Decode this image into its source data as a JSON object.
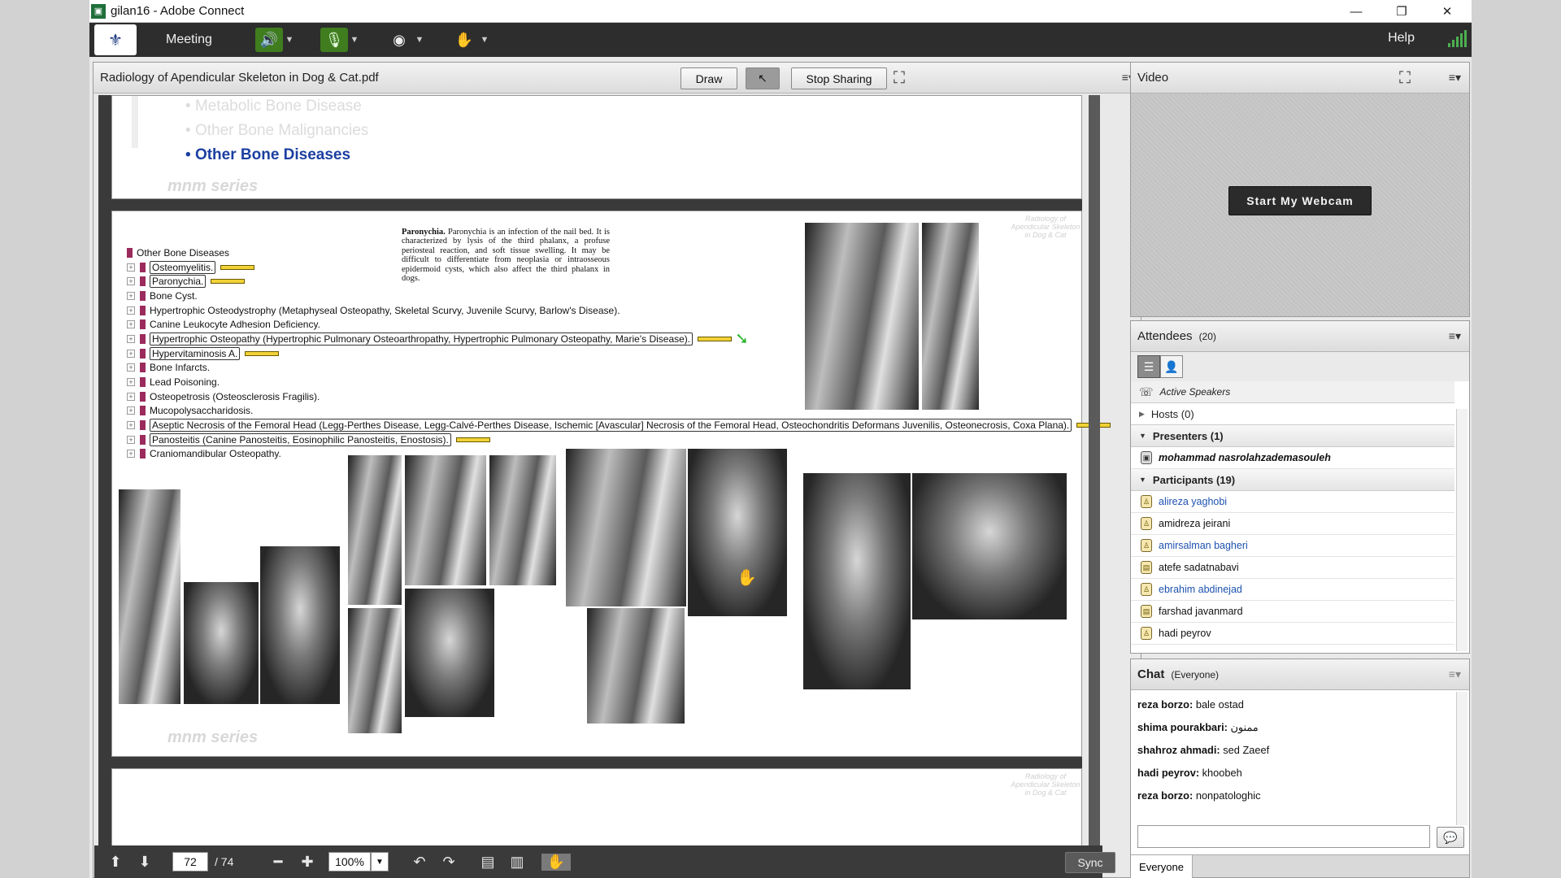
{
  "window": {
    "title": "gilan16 - Adobe Connect"
  },
  "menubar": {
    "meeting": "Meeting",
    "help": "Help"
  },
  "share_pod": {
    "title": "Radiology of Apendicular Skeleton in Dog & Cat.pdf",
    "draw": "Draw",
    "stop_sharing": "Stop Sharing"
  },
  "page_top": {
    "bullets": [
      "Metabolic Bone Disease",
      "Other Bone Malignancies",
      "Other Bone Diseases"
    ],
    "series": "mnm series"
  },
  "page_main": {
    "tree_title": "Other Bone Diseases",
    "items": [
      "Osteomyelitis.",
      "Paronychia.",
      "Bone Cyst.",
      "Hypertrophic Osteodystrophy (Metaphyseal Osteopathy, Skeletal Scurvy, Juvenile Scurvy, Barlow's Disease).",
      "Canine Leukocyte Adhesion Deficiency.",
      "Hypertrophic Osteopathy (Hypertrophic Pulmonary Osteoarthropathy, Hypertrophic Pulmonary Osteopathy, Marie's Disease).",
      "Hypervitaminosis A.",
      "Bone Infarcts.",
      "Lead Poisoning.",
      "Osteopetrosis (Osteosclerosis Fragilis).",
      "Mucopolysaccharidosis.",
      "Aseptic Necrosis of the Femoral Head (Legg-Perthes Disease, Legg-Calvé-Perthes Disease, Ischemic [Avascular] Necrosis of the Femoral Head, Osteochondritis Deformans Juvenilis, Osteonecrosis, Coxa Plana).",
      "Panosteitis (Canine Panosteitis, Eosinophilic Panosteitis, Enostosis).",
      "Craniomandibular Osteopathy."
    ],
    "paragraph_head": "Paronychia.",
    "paragraph": "Paronychia is an infection of the nail bed. It is characterized by lysis of the third phalanx, a profuse periosteal reaction, and soft tissue swelling. It may be difficult to differentiate from neoplasia or intraosseous epidermoid cysts, which also affect the third phalanx in dogs.",
    "watermark": "Radiology of Apendicular Skeleton in Dog & Cat",
    "series": "mnm series"
  },
  "page_bottom": {
    "watermark": "Radiology of Apendicular Skeleton in Dog & Cat"
  },
  "nav": {
    "page": "72",
    "total": "/ 74",
    "zoom": "100%",
    "sync": "Sync"
  },
  "video_pod": {
    "title": "Video",
    "start_webcam": "Start My Webcam"
  },
  "attendees_pod": {
    "title": "Attendees",
    "count": "(20)",
    "active_speakers": "Active Speakers",
    "hosts": "Hosts (0)",
    "presenters": "Presenters (1)",
    "presenter_name": "mohammad nasrolahzademasouleh",
    "participants": "Participants (19)",
    "participant_names": [
      "alireza yaghobi",
      "amidreza jeirani",
      "amirsalman bagheri",
      "atefe sadatnabavi",
      "ebrahim abdinejad",
      "farshad javanmard",
      "hadi peyrov"
    ]
  },
  "chat_pod": {
    "title": "Chat",
    "scope": "(Everyone)",
    "messages": [
      {
        "from": "reza borzo:",
        "text": "bale ostad"
      },
      {
        "from": "shima pourakbari:",
        "text": "ممنون"
      },
      {
        "from": "shahroz ahmadi:",
        "text": "sed Zaeef"
      },
      {
        "from": "hadi peyrov:",
        "text": "khoobeh"
      },
      {
        "from": "reza borzo:",
        "text": "nonpatologhic"
      }
    ],
    "tab": "Everyone"
  },
  "colors": {
    "accent_blue": "#1b3fa0",
    "participant_blue": "#1d52b0",
    "menubar": "#2d2d2d",
    "green": "#4caf50"
  }
}
